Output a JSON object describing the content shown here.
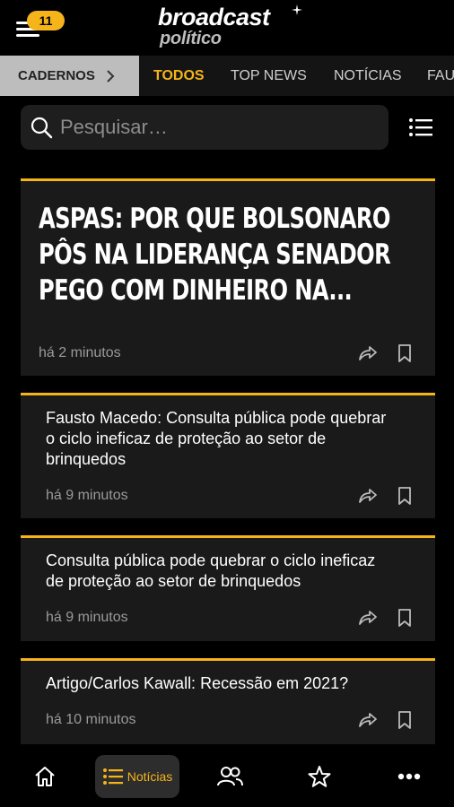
{
  "header": {
    "notification_count": "11",
    "logo_main": "broadcast",
    "logo_sub": "político"
  },
  "tabs": {
    "cadernos_label": "CADERNOS",
    "items": [
      {
        "label": "TODOS",
        "active": true
      },
      {
        "label": "TOP NEWS",
        "active": false
      },
      {
        "label": "NOTÍCIAS",
        "active": false
      },
      {
        "label": "FAU",
        "active": false
      }
    ]
  },
  "search": {
    "placeholder": "Pesquisar…"
  },
  "articles": [
    {
      "title": "ASPAS: Por que Bolsonaro pôs na liderança senador pego com dinheiro na...",
      "time": "há 2 minutos"
    },
    {
      "title": "Fausto Macedo: Consulta pública pode quebrar o ciclo ineficaz de proteção ao setor de brinquedos",
      "time": "há 9 minutos"
    },
    {
      "title": "Consulta pública pode quebrar o ciclo ineficaz de proteção ao setor de brinquedos",
      "time": "há 9 minutos"
    },
    {
      "title": "Artigo/Carlos Kawall: Recessão em 2021?",
      "time": "há 10 minutos"
    }
  ],
  "bottom_nav": {
    "active_label": "Notícias",
    "items": [
      "home-icon",
      "list-icon",
      "people-icon",
      "star-icon",
      "more-icon"
    ]
  },
  "colors": {
    "accent": "#f5b41a",
    "background": "#000000",
    "card": "#1a1a1a",
    "muted_text": "#9a9a9a"
  }
}
